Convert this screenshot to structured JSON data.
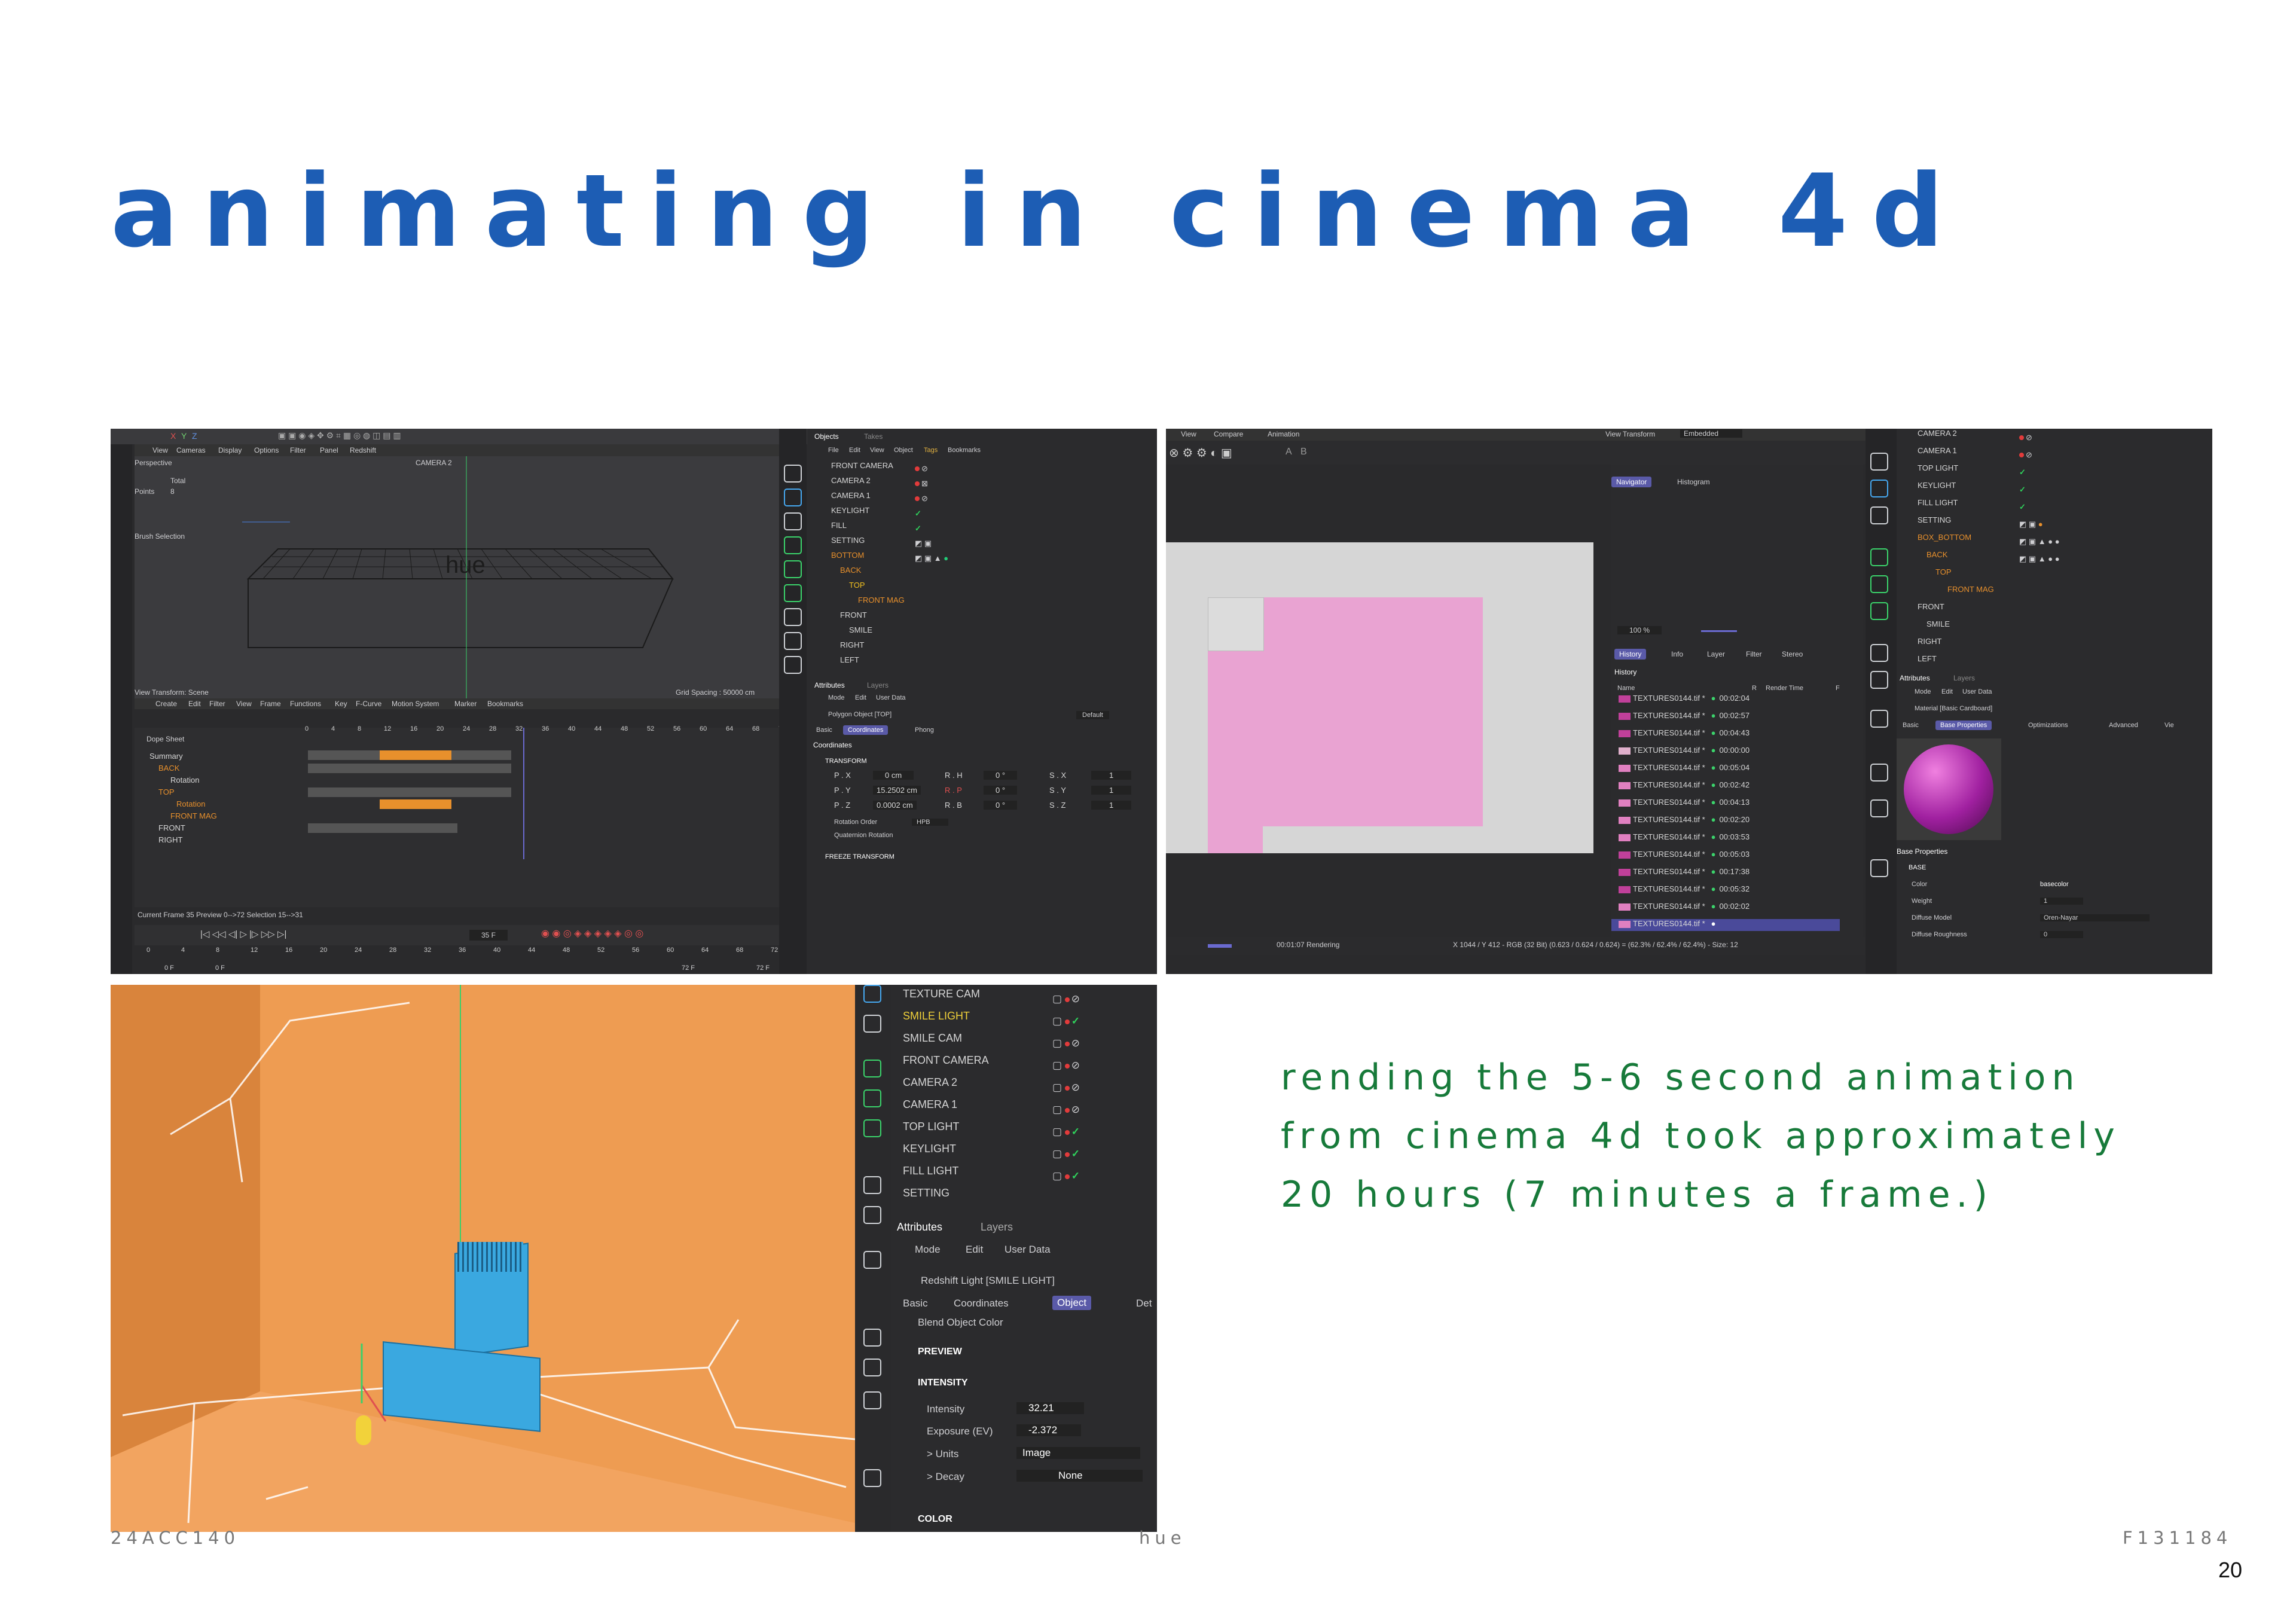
{
  "title": "animating in cinema 4d",
  "caption": {
    "line1": "rending the 5-6 second animation",
    "line2": "from cinema 4d took approximately",
    "line3": "20 hours (7 minutes a frame.)"
  },
  "footer": {
    "left": "24ACC140",
    "center": "hue",
    "right": "F131184",
    "page_number": "20"
  },
  "colors": {
    "title": "#1d5db4",
    "caption": "#177a3a",
    "c4d_dark": "#2a2a2c",
    "c4d_accent": "#5a5aa8",
    "render_pink": "#e8a0d0",
    "viewport_orange": "#e8954a",
    "box_blue": "#3aa8e0"
  },
  "shot1": {
    "menu": [
      "View",
      "Cameras",
      "Display",
      "Options",
      "Filter",
      "Panel",
      "Redshift"
    ],
    "axes": [
      "X",
      "Y",
      "Z"
    ],
    "viewport_label": "Perspective",
    "camera_label": "CAMERA 2",
    "total_label": "Total",
    "points_label": "Points",
    "points_value": "8",
    "brush_label": "Brush Selection",
    "view_transform": "View Transform: Scene",
    "grid_spacing": "Grid Spacing : 50000 cm",
    "model_text": "hue",
    "timeline_menu": [
      "Create",
      "Edit",
      "Filter",
      "View",
      "Frame",
      "Functions",
      "Key",
      "F-Curve",
      "Motion System",
      "Marker",
      "Bookmarks"
    ],
    "dope_sheet": "Dope Sheet",
    "ruler": [
      "0",
      "4",
      "8",
      "12",
      "16",
      "20",
      "24",
      "28",
      "32",
      "36",
      "40",
      "44",
      "48",
      "52",
      "56",
      "60",
      "64",
      "68",
      "72"
    ],
    "tracks": [
      "Summary",
      "BACK",
      "Rotation",
      "TOP",
      "Rotation",
      "FRONT MAG",
      "FRONT",
      "RIGHT"
    ],
    "status": "Current Frame 35  Preview 0-->72  Selection 15-->31",
    "frame_field": "35 F",
    "bottom_ruler": [
      "0",
      "4",
      "8",
      "12",
      "16",
      "20",
      "24",
      "28",
      "32",
      "36",
      "40",
      "44",
      "48",
      "52",
      "56",
      "60",
      "64",
      "68",
      "72"
    ],
    "start_field": "0 F",
    "start_field2": "0 F",
    "end_field": "72 F",
    "end_field2": "72 F",
    "objects_tabs": [
      "Objects",
      "Takes"
    ],
    "objects_menu": [
      "File",
      "Edit",
      "View",
      "Object",
      "Tags",
      "Bookmarks"
    ],
    "objects": [
      "FRONT CAMERA",
      "CAMERA 2",
      "CAMERA 1",
      "KEYLIGHT",
      "FILL",
      "SETTING",
      "BOTTOM",
      "BACK",
      "TOP",
      "FRONT MAG",
      "FRONT",
      "SMILE",
      "RIGHT",
      "LEFT"
    ],
    "attr_tabs": [
      "Attributes",
      "Layers"
    ],
    "attr_menu": [
      "Mode",
      "Edit",
      "User Data"
    ],
    "attr_object": "Polygon Object [TOP]",
    "attr_default": "Default",
    "sub_tabs": [
      "Basic",
      "Coordinates",
      "Phong"
    ],
    "coords_title": "Coordinates",
    "transform_label": "TRANSFORM",
    "coords": [
      [
        "P . X",
        "0 cm",
        "R . H",
        "0 °",
        "S . X",
        "1"
      ],
      [
        "P . Y",
        "15.2502 cm",
        "R . P",
        "0 °",
        "S . Y",
        "1"
      ],
      [
        "P . Z",
        "0.0002 cm",
        "R . B",
        "0 °",
        "S . Z",
        "1"
      ]
    ],
    "rotation_order_label": "Rotation Order",
    "rotation_order_value": "HPB",
    "quaternion_label": "Quaternion Rotation",
    "freeze_label": "FREEZE TRANSFORM"
  },
  "shot2": {
    "menu": [
      "View",
      "Compare",
      "Animation"
    ],
    "view_transform_label": "View Transform",
    "view_transform_value": "Embedded",
    "toolbar_letters": [
      "A",
      "B"
    ],
    "nav_tabs": [
      "Navigator",
      "Histogram"
    ],
    "zoom": "100 %",
    "hist_tabs": [
      "History",
      "Info",
      "Layer",
      "Filter",
      "Stereo"
    ],
    "history_title": "History",
    "columns": [
      "Name",
      "R",
      "Render Time",
      "F"
    ],
    "history": [
      [
        "TEXTURES0144.tif *",
        "00:02:04"
      ],
      [
        "TEXTURES0144.tif *",
        "00:02:57"
      ],
      [
        "TEXTURES0144.tif *",
        "00:04:43"
      ],
      [
        "TEXTURES0144.tif *",
        "00:00:00"
      ],
      [
        "TEXTURES0144.tif *",
        "00:05:04"
      ],
      [
        "TEXTURES0144.tif *",
        "00:02:42"
      ],
      [
        "TEXTURES0144.tif *",
        "00:04:13"
      ],
      [
        "TEXTURES0144.tif *",
        "00:02:20"
      ],
      [
        "TEXTURES0144.tif *",
        "00:03:53"
      ],
      [
        "TEXTURES0144.tif *",
        "00:05:03"
      ],
      [
        "TEXTURES0144.tif *",
        "00:17:38"
      ],
      [
        "TEXTURES0144.tif *",
        "00:05:32"
      ],
      [
        "TEXTURES0144.tif *",
        "00:02:02"
      ],
      [
        "TEXTURES0144.tif *",
        ""
      ]
    ],
    "render_status": "00:01:07 Rendering",
    "pixel_info": "X 1044 / Y 412 - RGB (32 Bit) (0.623 / 0.624 / 0.624) = (62.3% / 62.4% / 62.4%) - Size: 12",
    "objects": [
      "CAMERA 2",
      "CAMERA 1",
      "TOP LIGHT",
      "KEYLIGHT",
      "FILL LIGHT",
      "SETTING",
      "BOX_BOTTOM",
      "BACK",
      "TOP",
      "FRONT MAG",
      "FRONT",
      "SMILE",
      "RIGHT",
      "LEFT"
    ],
    "attr_tabs": [
      "Attributes",
      "Layers"
    ],
    "attr_menu": [
      "Mode",
      "Edit",
      "User Data"
    ],
    "material": "Material [Basic Cardboard]",
    "mat_tabs": [
      "Basic",
      "Base Properties",
      "Optimizations",
      "Advanced",
      "Vie"
    ],
    "base_props": "Base Properties",
    "base_label": "BASE",
    "props": [
      [
        "Color",
        "basecolor"
      ],
      [
        "Weight",
        "1"
      ],
      [
        "Diffuse Model",
        "Oren-Nayar"
      ],
      [
        "Diffuse Roughness",
        "0"
      ]
    ]
  },
  "shot3": {
    "objects": [
      "TEXTURE CAM",
      "SMILE LIGHT",
      "SMILE CAM",
      "FRONT CAMERA",
      "CAMERA 2",
      "CAMERA 1",
      "TOP LIGHT",
      "KEYLIGHT",
      "FILL LIGHT",
      "SETTING"
    ],
    "attr_tabs": [
      "Attributes",
      "Layers"
    ],
    "attr_menu": [
      "Mode",
      "Edit",
      "User Data"
    ],
    "light_name": "Redshift Light [SMILE LIGHT]",
    "sub_tabs": [
      "Basic",
      "Coordinates",
      "Object",
      "Det"
    ],
    "blend_label": "Blend Object Color",
    "preview_label": "PREVIEW",
    "intensity_label": "INTENSITY",
    "props": [
      [
        "Intensity",
        "32.21"
      ],
      [
        "Exposure (EV)",
        "-2.372"
      ],
      [
        "> Units",
        "Image"
      ],
      [
        "> Decay",
        "None"
      ]
    ],
    "color_label": "COLOR"
  }
}
